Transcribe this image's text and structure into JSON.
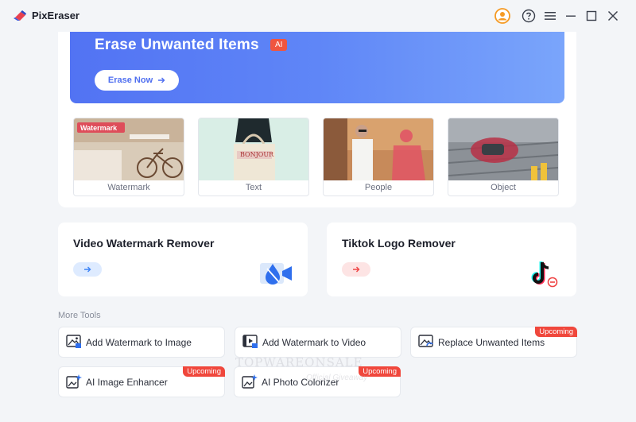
{
  "app": {
    "title": "PixEraser"
  },
  "banner": {
    "title": "Erase Unwanted Items",
    "badge": "AI",
    "button": "Erase Now"
  },
  "samples": [
    {
      "caption": "Watermark",
      "overlay": "Watermark"
    },
    {
      "caption": "Text",
      "overlay": "BONJOUR"
    },
    {
      "caption": "People"
    },
    {
      "caption": "Object"
    }
  ],
  "cards": [
    {
      "title": "Video Watermark Remover",
      "accent": "#3b82f6"
    },
    {
      "title": "Tiktok Logo Remover",
      "accent": "#ef4444"
    }
  ],
  "more_tools": {
    "label": "More Tools",
    "items": [
      {
        "label": "Add Watermark to Image",
        "icon": "image-icon"
      },
      {
        "label": "Add Watermark to Video",
        "icon": "video-icon"
      },
      {
        "label": "Replace Unwanted Items",
        "icon": "replace-image-icon",
        "badge": "Upcoming"
      },
      {
        "label": "AI Image Enhancer",
        "icon": "enhance-icon",
        "badge": "Upcoming"
      },
      {
        "label": "AI Photo Colorizer",
        "icon": "colorize-icon",
        "badge": "Upcoming"
      }
    ]
  },
  "watermark": {
    "main": "TOPWAREONSALE",
    "sub": "Official Giveaway"
  },
  "colors": {
    "accent": "#5273f3",
    "badge": "#f0473c"
  }
}
